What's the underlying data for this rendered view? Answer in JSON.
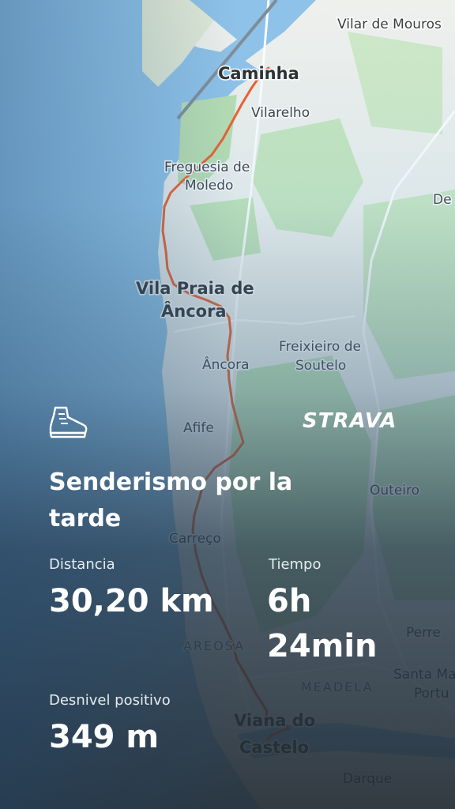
{
  "map": {
    "places": {
      "vilar_de_mouros": "Vilar de Mouros",
      "caminha": "Caminha",
      "vilarelho": "Vilarelho",
      "moledo_1": "Freguesia de",
      "moledo_2": "Moledo",
      "de_edge": "De",
      "vila_praia_1": "Vila Praia de",
      "vila_praia_2": "Âncora",
      "freixieiro_1": "Freixieiro de",
      "freixieiro_2": "Soutelo",
      "ancora": "Âncora",
      "afife": "Afife",
      "outeiro": "Outeiro",
      "carreco": "Carreço",
      "areosa": "AREOSA",
      "perre": "Perre",
      "meadela": "MEADELA",
      "santa_ma": "Santa Ma",
      "portu": "Portu",
      "viana_1": "Viana do",
      "viana_2": "Castelo",
      "darque": "Darque"
    },
    "colors": {
      "route": "#f05a23",
      "water": "#8fc2e8",
      "land": "#eef0ec",
      "forest": "#bfe3b5"
    }
  },
  "activity": {
    "icon": "hiking-boot-icon",
    "brand": "STRAVA",
    "title": "Senderismo por la tarde",
    "stats": {
      "distance": {
        "label": "Distancia",
        "value": "30,20 km"
      },
      "time": {
        "label": "Tiempo",
        "value_line1": "6h",
        "value_line2": "24min"
      },
      "elevation": {
        "label": "Desnivel positivo",
        "value": "349 m"
      }
    }
  }
}
